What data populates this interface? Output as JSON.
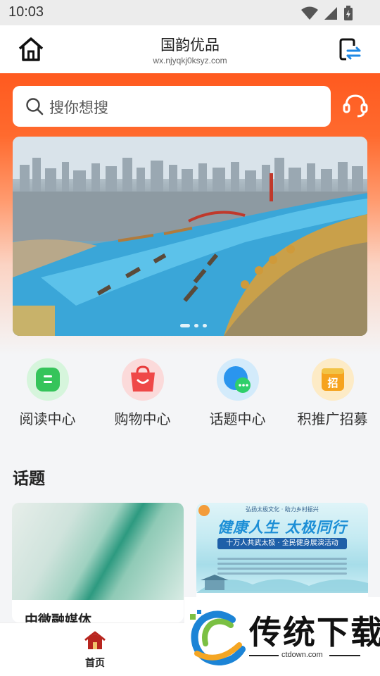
{
  "status_bar": {
    "time": "10:03"
  },
  "header": {
    "title": "国韵优品",
    "subtitle": "wx.njyqkj0ksyz.com"
  },
  "search": {
    "placeholder": "搜你想搜"
  },
  "quick_menu": [
    {
      "label": "阅读中心",
      "icon": "reading-icon",
      "color": "#3fcf61"
    },
    {
      "label": "购物中心",
      "icon": "shopping-bag-icon",
      "color": "#f24d4d"
    },
    {
      "label": "话题中心",
      "icon": "chat-bubble-icon",
      "color": "#2c9cf0"
    },
    {
      "label": "积推广招募",
      "icon": "recruit-icon",
      "color": "#f5a623"
    }
  ],
  "section": {
    "title": "话题"
  },
  "cards": [
    {
      "title": "中微融媒体"
    },
    {
      "poster_top": "弘扬太极文化 · 助力乡村振兴",
      "poster_headline": "健康人生  太极同行",
      "poster_bar": "十万人共武太极 · 全民健身展演活动"
    }
  ],
  "bottom_nav": {
    "home_label": "首页"
  },
  "watermark": {
    "brand": "传统下载",
    "url": "ctdown.com"
  },
  "colors": {
    "accent": "#ff5a1f",
    "nav_active": "#b8261f"
  }
}
